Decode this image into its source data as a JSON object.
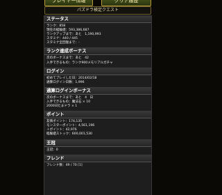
{
  "nav": {
    "left_tab": "プレイヤー情報",
    "right_tab": "クリア履歴",
    "quest_button": "パズドラ検定クエスト"
  },
  "sections": {
    "status": {
      "title": "ステータス",
      "rows": [
        "ランク：858",
        "現在の経験値：593,386,687",
        "ランクアップまで：あと　1,190,993",
        "スタミナ：440 / 445",
        "スタミナ全回復まで：-"
      ]
    },
    "rank_bonus": {
      "title": "ランク達成ボーナス",
      "rows": [
        "次のボーナスまで：あと　42",
        "入手できるもの：ランク900メモリアルガチャ"
      ]
    },
    "login": {
      "title": "ログイン",
      "rows": [
        "初めてプレイした日：2014/02/18",
        "通算ログイン日数：1,996"
      ]
    },
    "login_bonus": {
      "title": "通算ログインボーナス",
      "rows": [
        "次のボーナスまで：あと　4　日",
        "入手できるもの：魔法石 × 10",
        "2000日たまドラ × 1"
      ]
    },
    "points": {
      "title": "ポイント",
      "rows": [
        "友情ポイント：174,135",
        "モンスターポイント：4,561,196",
        "＋ポイント：42,976",
        "経験値ストック：600,001,530"
      ]
    },
    "king": {
      "title": "王冠",
      "rows": [
        "王冠：0"
      ]
    },
    "friend": {
      "title": "フレンド",
      "rows": [
        "フレンド数：49 / 70 [1]"
      ]
    }
  }
}
